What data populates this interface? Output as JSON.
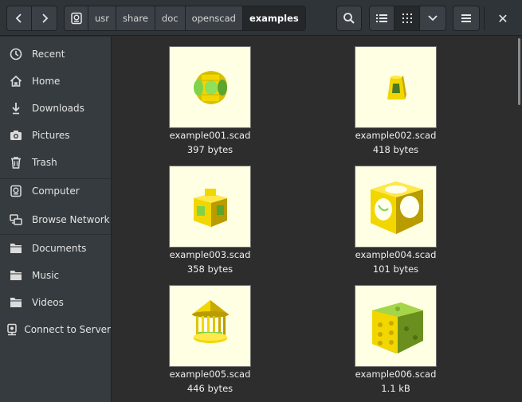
{
  "header": {
    "breadcrumbs": [
      "usr",
      "share",
      "doc",
      "openscad",
      "examples"
    ],
    "breadcrumb_icons": [
      "drive-icon"
    ],
    "buttons": {
      "back": "chevron-left-icon",
      "forward": "chevron-right-icon",
      "search": "search-icon",
      "list_view": "list-view-icon",
      "grid_view": "grid-view-icon",
      "view_options": "chevron-down-icon",
      "menu": "hamburger-menu-icon",
      "close": "✕"
    }
  },
  "sidebar": {
    "items": [
      {
        "label": "Recent",
        "icon": "clock-icon"
      },
      {
        "label": "Home",
        "icon": "home-icon"
      },
      {
        "label": "Downloads",
        "icon": "download-icon"
      },
      {
        "label": "Pictures",
        "icon": "camera-icon"
      },
      {
        "label": "Trash",
        "icon": "trash-icon"
      },
      {
        "label": "Computer",
        "icon": "drive-icon"
      },
      {
        "label": "Browse Network",
        "icon": "network-icon"
      },
      {
        "label": "Documents",
        "icon": "folder-icon"
      },
      {
        "label": "Music",
        "icon": "folder-icon"
      },
      {
        "label": "Videos",
        "icon": "folder-icon"
      },
      {
        "label": "Connect to Server",
        "icon": "server-icon"
      }
    ]
  },
  "files": [
    {
      "name": "example001.scad",
      "size": "397 bytes"
    },
    {
      "name": "example002.scad",
      "size": "418 bytes"
    },
    {
      "name": "example003.scad",
      "size": "358 bytes"
    },
    {
      "name": "example004.scad",
      "size": "101 bytes"
    },
    {
      "name": "example005.scad",
      "size": "446 bytes"
    },
    {
      "name": "example006.scad",
      "size": "1.1 kB"
    }
  ],
  "colors": {
    "header_bg": "#2f3438",
    "sidebar_bg": "#353b3f",
    "content_bg": "#2d2d2d",
    "thumb_bg": "#ffffe3",
    "model_yellow": "#f2d600",
    "model_green": "#7fd24a"
  }
}
